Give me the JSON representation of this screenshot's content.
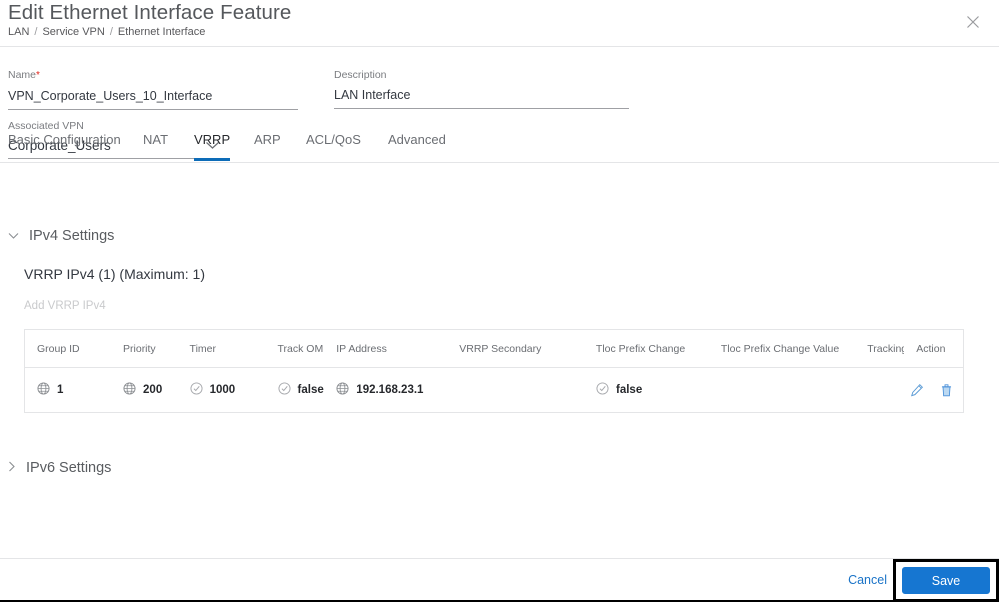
{
  "header": {
    "title": "Edit Ethernet Interface Feature",
    "breadcrumb": [
      "LAN",
      "Service VPN",
      "Ethernet Interface"
    ],
    "close_icon": "close-icon"
  },
  "form": {
    "name": {
      "label": "Name",
      "required_mark": "*",
      "value": "VPN_Corporate_Users_10_Interface"
    },
    "description": {
      "label": "Description",
      "value": "LAN Interface"
    },
    "associated_vpn": {
      "label": "Associated VPN",
      "value": "Corporate_Users",
      "chevron_icon": "chevron-down-icon"
    }
  },
  "tabs": [
    {
      "label": "Basic Configuration",
      "active": false
    },
    {
      "label": "NAT",
      "active": false
    },
    {
      "label": "VRRP",
      "active": true
    },
    {
      "label": "ARP",
      "active": false
    },
    {
      "label": "ACL/QoS",
      "active": false
    },
    {
      "label": "Advanced",
      "active": false
    }
  ],
  "sections": {
    "ipv4": {
      "title": "IPv4 Settings",
      "expanded": true,
      "chevron_icon": "chevron-down-icon",
      "subtitle": "VRRP IPv4 (1) (Maximum: 1)",
      "add_link": "Add VRRP IPv4"
    },
    "ipv6": {
      "title": "IPv6 Settings",
      "expanded": false,
      "chevron_icon": "chevron-right-icon"
    }
  },
  "table": {
    "columns": [
      "Group ID",
      "Priority",
      "Timer",
      "Track OMP",
      "IP Address",
      "VRRP Secondary",
      "Tloc Prefix Change",
      "Tloc Prefix Change Value",
      "Tracking",
      "Action"
    ],
    "rows": [
      {
        "group_id": {
          "value": "1",
          "icon": "globe-icon"
        },
        "priority": {
          "value": "200",
          "icon": "globe-icon"
        },
        "timer": {
          "value": "1000",
          "icon": "check-circle-icon"
        },
        "track_omp": {
          "value": "false",
          "icon": "check-circle-icon"
        },
        "ip_address": {
          "value": "192.168.23.1",
          "icon": "globe-icon"
        },
        "vrrp_secondary": {
          "value": "",
          "icon": ""
        },
        "tloc_prefix_change": {
          "value": "false",
          "icon": "check-circle-icon"
        },
        "tloc_prefix_change_value": {
          "value": "",
          "icon": ""
        },
        "tracking": {
          "value": "",
          "icon": ""
        },
        "actions": {
          "edit_icon": "pencil-edit-icon",
          "delete_icon": "trash-delete-icon"
        }
      }
    ]
  },
  "footer": {
    "cancel_label": "Cancel",
    "save_label": "Save"
  },
  "colors": {
    "accent_blue": "#1676d1",
    "tab_underline": "#0d6cb8",
    "link_blue": "#1a73c7",
    "required_red": "#e2231a",
    "icon_gray": "#9a9b9e"
  }
}
